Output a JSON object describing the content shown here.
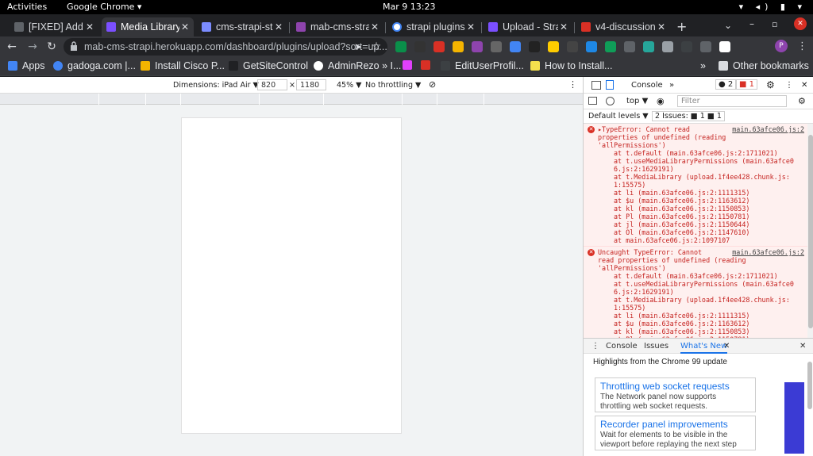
{
  "topbar": {
    "activities": "Activities",
    "app": "Google Chrome ▾",
    "clock": "Mar 9  13:23",
    "tray": "▾ ◂) ▮ ▾"
  },
  "tabs": [
    {
      "title": "[FIXED] Add b",
      "color": "#5f6368"
    },
    {
      "title": "Media Library",
      "color": "#7b4fff"
    },
    {
      "title": "cms-strapi-sto",
      "color": "#7b8cff"
    },
    {
      "title": "mab-cms-strap",
      "color": "#8e44ad"
    },
    {
      "title": "strapi plugins",
      "color": "#ffffff"
    },
    {
      "title": "Upload - Strap",
      "color": "#7b4fff"
    },
    {
      "title": "v4-discussion",
      "color": "#d93025"
    }
  ],
  "tab_close": "✕",
  "new_tab": "+",
  "window_controls": [
    "⌄",
    "–",
    "▫",
    "✕"
  ],
  "toolbar": {
    "back": "←",
    "forward": "→",
    "reload": "↻",
    "url": "mab-cms-strapi.herokuapp.com/dashboard/plugins/upload?sort=up...",
    "send": "➤",
    "star": "☆"
  },
  "extensions": [
    "#0a8f4a",
    "#333333",
    "#d93025",
    "#f4b400",
    "#8e44ad",
    "#666666",
    "#4285f4",
    "#222222",
    "#ffcc00",
    "#444444",
    "#1e88e5",
    "#0f9d58",
    "#5f6368",
    "#26a69a",
    "#9aa0a6",
    "#3c4043",
    "#5f6368",
    "#ffffff"
  ],
  "profile": "P",
  "menu": "⋮",
  "bookmarks": [
    {
      "label": "Apps",
      "color": "#4285f4"
    },
    {
      "label": "gadoga.com |...",
      "color": "#4285f4"
    },
    {
      "label": "Install Cisco P...",
      "color": "#f4b400"
    },
    {
      "label": "GetSiteControl",
      "color": "#202124"
    },
    {
      "label": "AdminRezo » I...",
      "color": "#ffffff"
    },
    {
      "label": "",
      "color": "#e040fb"
    },
    {
      "label": "",
      "color": "#d93025"
    },
    {
      "label": "EditUserProfil...",
      "color": "#3c4043"
    },
    {
      "label": "How to Install...",
      "color": "#f4e04d"
    }
  ],
  "bookmarks_more": "»",
  "other_bookmarks": "Other bookmarks",
  "device_toolbar": {
    "dimensions": "Dimensions: iPad Air ▼",
    "width": "820",
    "times": "×",
    "height": "1180",
    "zoom": "45% ▼",
    "throttle": "No throttling ▼",
    "rotate": "⊘",
    "menu": "⋮"
  },
  "devtools": {
    "tab_console": "Console",
    "tab_more": "»",
    "badge_errors": "● 2",
    "badge_issues": "■ 1",
    "settings": "⚙",
    "menu": "⋮",
    "close": "✕",
    "context": "top ▼",
    "eye": "◉",
    "filter_placeholder": "Filter",
    "levels": "Default levels ▼",
    "issues": "2 Issues: ■ 1 ■ 1"
  },
  "console_errors": [
    {
      "src": "main.63afce06.js:2",
      "lines": [
        "▸TypeError: Cannot read",
        "properties of undefined (reading",
        "'allPermissions')"
      ],
      "trace": [
        "at t.default (main.63afce06.js:2:1711021)",
        "at t.useMediaLibraryPermissions (main.63afce0",
        "6.js:2:1629191)",
        "at t.MediaLibrary (upload.1f4ee428.chunk.js:",
        "1:15575)",
        "at li (main.63afce06.js:2:1111315)",
        "at $u (main.63afce06.js:2:1163612)",
        "at kl (main.63afce06.js:2:1150853)",
        "at Pl (main.63afce06.js:2:1150781)",
        "at jl (main.63afce06.js:2:1150644)",
        "at Ol (main.63afce06.js:2:1147610)",
        "at main.63afce06.js:2:1097107"
      ]
    },
    {
      "src": "main.63afce06.js:2",
      "lines": [
        "Uncaught TypeError: Cannot",
        "read properties of undefined (reading",
        "'allPermissions')"
      ],
      "trace": [
        "at t.default (main.63afce06.js:2:1711021)",
        "at t.useMediaLibraryPermissions (main.63afce0",
        "6.js:2:1629191)",
        "at t.MediaLibrary (upload.1f4ee428.chunk.js:",
        "1:15575)",
        "at li (main.63afce06.js:2:1111315)",
        "at $u (main.63afce06.js:2:1163612)",
        "at kl (main.63afce06.js:2:1150853)",
        "at Pl (main.63afce06.js:2:1150781)"
      ]
    }
  ],
  "drawer": {
    "menu": "⋮",
    "tab_console": "Console",
    "tab_issues": "Issues",
    "tab_whatsnew": "What's New",
    "close_tab": "✕",
    "close": "✕"
  },
  "whatsnew": {
    "highlights": "Highlights from the Chrome 99 update",
    "cards": [
      {
        "title": "Throttling web socket requests",
        "desc1": "The Network panel now supports",
        "desc2": "throttling web socket requests."
      },
      {
        "title": "Recorder panel improvements",
        "desc1": "Wait for elements to be visible in the",
        "desc2": "viewport before replaying the next step"
      }
    ]
  }
}
